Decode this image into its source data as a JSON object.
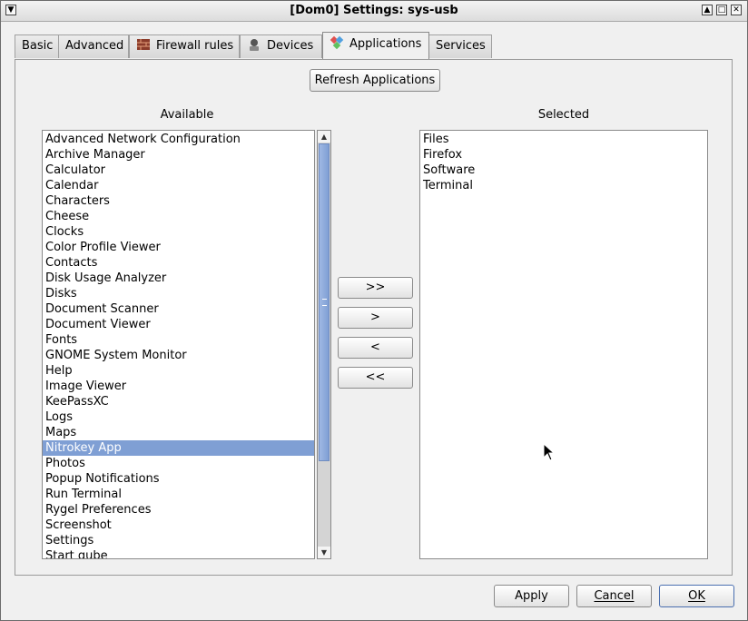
{
  "window": {
    "title": "[Dom0] Settings: sys-usb"
  },
  "tabs": [
    {
      "label": "Basic"
    },
    {
      "label": "Advanced"
    },
    {
      "label": "Firewall rules"
    },
    {
      "label": "Devices"
    },
    {
      "label": "Applications"
    },
    {
      "label": "Services"
    }
  ],
  "active_tab": "Applications",
  "refresh_button": "Refresh Applications",
  "available": {
    "label": "Available",
    "items": [
      "Advanced Network Configuration",
      "Archive Manager",
      "Calculator",
      "Calendar",
      "Characters",
      "Cheese",
      "Clocks",
      "Color Profile Viewer",
      "Contacts",
      "Disk Usage Analyzer",
      "Disks",
      "Document Scanner",
      "Document Viewer",
      "Fonts",
      "GNOME System Monitor",
      "Help",
      "Image Viewer",
      "KeePassXC",
      "Logs",
      "Maps",
      "Nitrokey App",
      "Photos",
      "Popup Notifications",
      "Run Terminal",
      "Rygel Preferences",
      "Screenshot",
      "Settings",
      "Start qube"
    ],
    "selected_item": "Nitrokey App"
  },
  "selected": {
    "label": "Selected",
    "items": [
      "Files",
      "Firefox",
      "Software",
      "Terminal"
    ]
  },
  "transfer_buttons": {
    "add_all": ">>",
    "add": ">",
    "remove": "<",
    "remove_all": "<<"
  },
  "footer": {
    "apply": "Apply",
    "cancel": "Cancel",
    "ok": "OK"
  },
  "colors": {
    "selection": "#7f9fd4",
    "background": "#f0f0f0"
  }
}
